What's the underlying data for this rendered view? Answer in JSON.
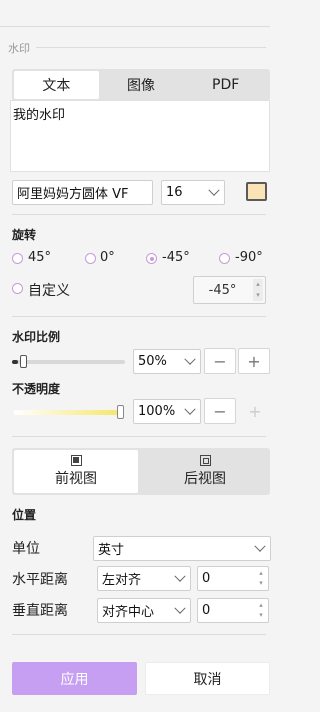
{
  "watermark": {
    "section_label": "水印",
    "tabs": [
      {
        "label": "文本",
        "active": true
      },
      {
        "label": "图像",
        "active": false
      },
      {
        "label": "PDF",
        "active": false
      }
    ],
    "text_value": "我的水印",
    "font_family_value": "阿里妈妈方圆体 VF",
    "font_size_value": "16",
    "color_swatch": "#fbe3b8"
  },
  "rotation": {
    "label": "旋转",
    "options": [
      {
        "label": "45°",
        "checked": false
      },
      {
        "label": "0°",
        "checked": false
      },
      {
        "label": "-45°",
        "checked": true
      },
      {
        "label": "-90°",
        "checked": false
      },
      {
        "label": "自定义",
        "checked": false
      }
    ],
    "custom_value": "-45°"
  },
  "scale": {
    "label": "水印比例",
    "value": "50%",
    "slider_fraction": 0.05,
    "minus": "−",
    "plus": "+"
  },
  "opacity": {
    "label": "不透明度",
    "value": "100%",
    "slider_fraction": 1.0,
    "minus": "−",
    "plus": "+"
  },
  "views": {
    "front_label": "前视图",
    "back_label": "后视图",
    "active": "front"
  },
  "position": {
    "label": "位置",
    "unit_label": "单位",
    "unit_value": "英寸",
    "horizontal_label": "水平距离",
    "horizontal_align": "左对齐",
    "horizontal_value": "0",
    "vertical_label": "垂直距离",
    "vertical_align": "对齐中心",
    "vertical_value": "0"
  },
  "actions": {
    "apply_label": "应用",
    "cancel_label": "取消"
  },
  "colors": {
    "accent": "#c79ff2",
    "radio_accent": "#c79bd8",
    "opacity_gradient_start": "#ffffff",
    "opacity_gradient_end": "#f5e66a"
  }
}
